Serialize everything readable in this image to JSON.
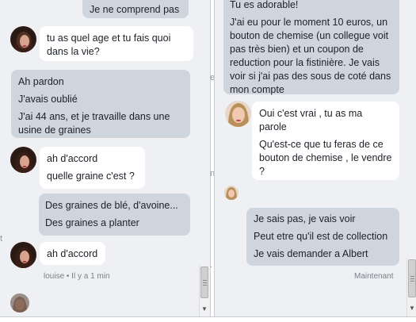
{
  "left_chat": {
    "msg_top": "Je ne comprend pas",
    "msg_question": "tu as quel  age et  tu  fais quoi dans  la vie?",
    "reply": {
      "line1": "Ah pardon",
      "line2": "J'avais oublié",
      "line3": "J'ai 44 ans, et je travaille dans une usine de graines"
    },
    "msg_daccord1": "ah d'accord",
    "msg_quelle_graine": "quelle graine c'est ?",
    "reply2": {
      "line1": "Des graines de blé, d'avoine...",
      "line2": "Des graines a planter"
    },
    "msg_daccord2": "ah d'accord",
    "timestamp": "louise • Il y a 1 min"
  },
  "right_chat": {
    "sent_top": {
      "line_cut": "Tu es adorable!",
      "para": "J'ai eu pour le moment 10 euros, un bouton de chemise (un collegue voit pas très bien) et un coupon de reduction pour la fistinière. Je vais voir si j'ai pas des sous de coté dans mon compte"
    },
    "recv": {
      "line1": "Oui c'est vrai , tu as ma parole",
      "line2": "Qu'est-ce que tu feras de ce bouton de chemise , le vendre ?"
    },
    "sent2": {
      "line1": "Je sais pas, je vais voir",
      "line2": "Peut etre qu'il est de collection",
      "line3": "Je vais demander a Albert"
    },
    "status": "Maintenant"
  },
  "edge_fragments": [
    "e",
    "n",
    "t",
    "."
  ],
  "colors": {
    "panel_bg": "#eef0f3",
    "sent_bubble": "#cfd5dc",
    "received_bubble": "#ffffff",
    "meta_text": "#7a8087"
  }
}
